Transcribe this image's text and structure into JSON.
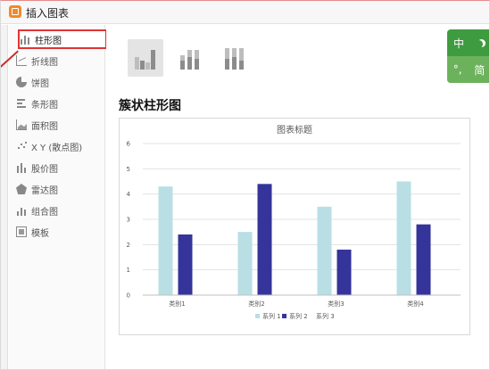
{
  "window": {
    "title": "插入图表"
  },
  "sidebar": {
    "items": [
      {
        "label": "柱形图",
        "icon": "column-chart-icon",
        "active": true
      },
      {
        "label": "折线图",
        "icon": "line-chart-icon"
      },
      {
        "label": "饼图",
        "icon": "pie-chart-icon"
      },
      {
        "label": "条形图",
        "icon": "bar-chart-icon"
      },
      {
        "label": "面积图",
        "icon": "area-chart-icon"
      },
      {
        "label": "X Y (散点图)",
        "icon": "scatter-chart-icon"
      },
      {
        "label": "股价图",
        "icon": "stock-chart-icon"
      },
      {
        "label": "雷达图",
        "icon": "radar-chart-icon"
      },
      {
        "label": "组合图",
        "icon": "combo-chart-icon"
      },
      {
        "label": "模板",
        "icon": "template-icon"
      }
    ]
  },
  "subtypes": [
    {
      "name": "clustered-column",
      "active": true
    },
    {
      "name": "stacked-column",
      "active": false
    },
    {
      "name": "percent-stacked-column",
      "active": false
    }
  ],
  "section_title": "簇状柱形图",
  "colors": {
    "series1": "#b9dfe4",
    "series2": "#35349a",
    "highlight": "#e03333",
    "ime_green": "#3f9b3f"
  },
  "ime": {
    "lang": "中",
    "mode": "简",
    "punct": "°,"
  },
  "chart_data": {
    "type": "bar",
    "title": "图表标题",
    "categories": [
      "类别1",
      "类别2",
      "类别3",
      "类别4"
    ],
    "series": [
      {
        "name": "系列 1",
        "values": [
          4.3,
          2.5,
          3.5,
          4.5
        ]
      },
      {
        "name": "系列 2",
        "values": [
          2.4,
          4.4,
          1.8,
          2.8
        ]
      },
      {
        "name": "系列 3",
        "values": [
          null,
          null,
          null,
          null
        ]
      }
    ],
    "ylim": [
      0,
      6
    ],
    "yticks": [
      0,
      1,
      2,
      3,
      4,
      5,
      6
    ],
    "grid": true,
    "legend": "bottom"
  }
}
